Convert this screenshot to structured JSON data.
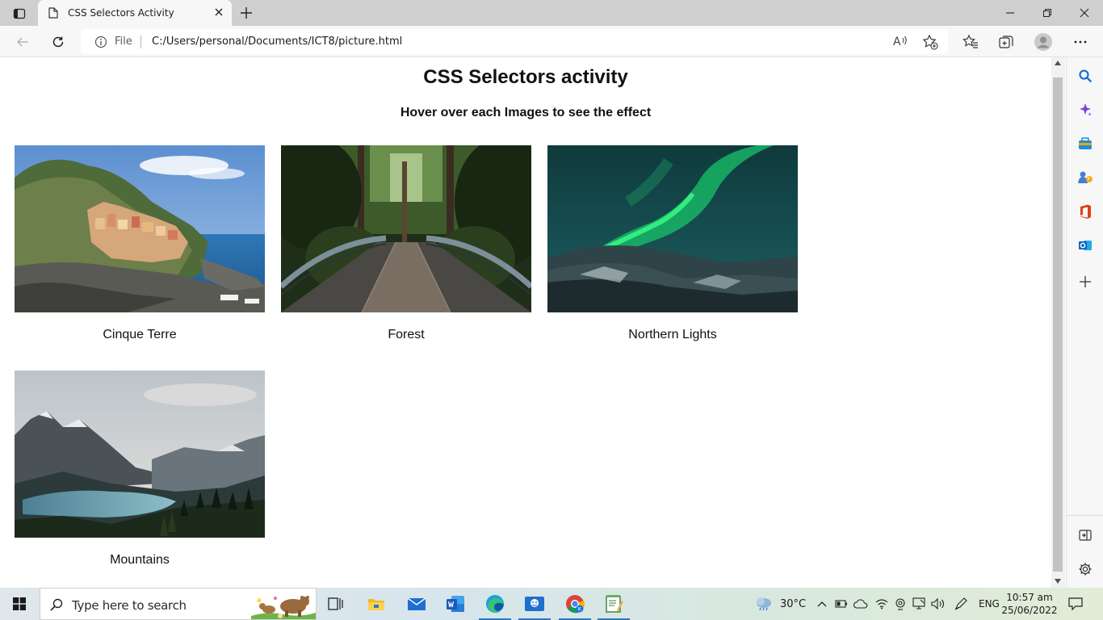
{
  "browser": {
    "tab_title": "CSS Selectors Activity",
    "address": {
      "scheme_label": "File",
      "url": "C:/Users/personal/Documents/ICT8/picture.html"
    }
  },
  "page": {
    "title": "CSS Selectors activity",
    "subtitle": "Hover over each Images to see the effect",
    "images": [
      {
        "caption": "Cinque Terre"
      },
      {
        "caption": "Forest"
      },
      {
        "caption": "Northern Lights"
      },
      {
        "caption": "Mountains"
      }
    ]
  },
  "sidebar": {
    "items": [
      "search-icon",
      "copilot-icon",
      "shopping-icon",
      "games-icon",
      "office-icon",
      "outlook-icon",
      "add-icon"
    ],
    "bottom": [
      "split-screen-icon",
      "settings-icon"
    ]
  },
  "taskbar": {
    "search_placeholder": "Type here to search",
    "apps": [
      "task-view-icon",
      "file-explorer-icon",
      "mail-icon",
      "word-icon",
      "edge-icon",
      "meet-icon",
      "chrome-icon",
      "notepad-icon"
    ],
    "weather": "30°C",
    "language": "ENG",
    "time": "10:57 am",
    "date": "25/06/2022"
  }
}
